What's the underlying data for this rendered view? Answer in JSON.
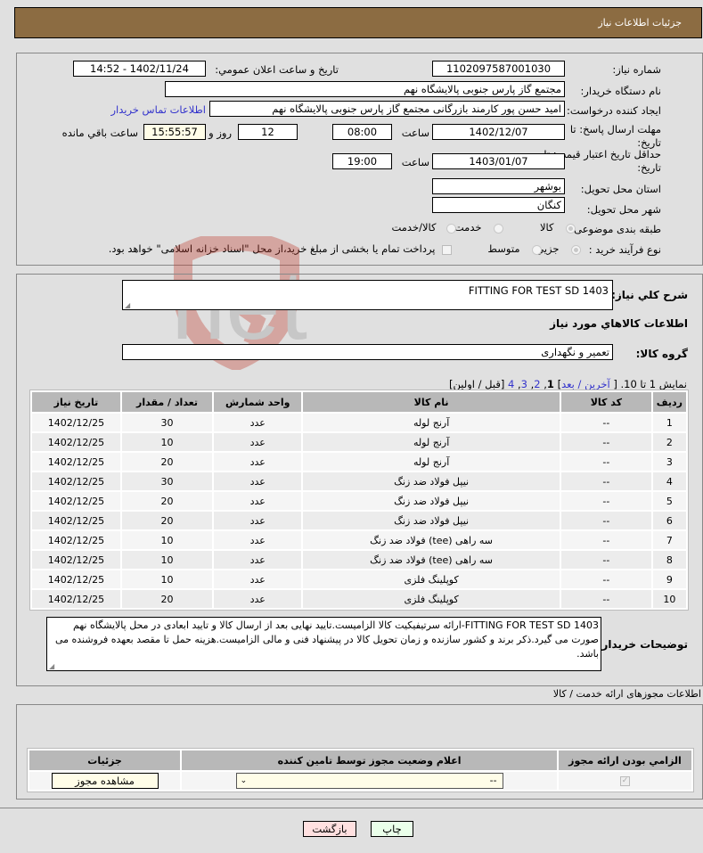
{
  "header": {
    "title": "جزئیات اطلاعات نیاز"
  },
  "details": {
    "need_number_label": "شماره نیاز:",
    "need_number": "1102097587001030",
    "announce_label": "تاریخ و ساعت اعلان عمومي:",
    "announce_value": "1402/11/24 - 14:52",
    "buyer_org_label": "نام دستگاه خریدار:",
    "buyer_org": "مجتمع گاز پارس جنوبی  پالایشگاه نهم",
    "creator_label": "ایجاد کننده درخواست:",
    "creator": "امید حسن پور کارمند بازرگانی مجتمع گاز پارس جنوبی  پالایشگاه نهم",
    "contact_link": "اطلاعات تماس خریدار",
    "reply_deadline_label_1": "مهلت ارسال پاسخ: تا",
    "reply_deadline_label_2": "تاریخ:",
    "reply_date": "1402/12/07",
    "time_label": "ساعت",
    "reply_time": "08:00",
    "days_value": "12",
    "days_label": "روز و",
    "remaining_time": "15:55:57",
    "remaining_label": "ساعت باقي مانده",
    "price_validity_label_1": "حداقل تاریخ اعتبار قیمت: تا",
    "price_validity_label_2": "تاریخ:",
    "price_validity_date": "1403/01/07",
    "price_validity_time": "19:00",
    "province_label": "استان محل تحویل:",
    "province": "بوشهر",
    "city_label": "شهر محل تحویل:",
    "city": "کنگان",
    "category_label": "طبقه بندی موضوعی:",
    "category_options": [
      "کالا",
      "خدمت",
      "کالا/خدمت"
    ],
    "category_selected": "کالا",
    "process_label": "نوع فرآیند خرید :",
    "process_options": [
      "جزیي",
      "متوسط"
    ],
    "process_selected": "جزیي",
    "payment_note": "پرداخت تمام یا بخشی از مبلغ خرید،از محل \"اسناد خزانه اسلامی\" خواهد بود."
  },
  "watermark": "AriaTender.net",
  "goods": {
    "summary_label": "شرح کلي نیاز:",
    "summary": "FITTING FOR TEST SD 1403",
    "section_title": "اطلاعات کالاهاي مورد نیاز",
    "group_label": "گروه کالا:",
    "group": "تعمیر و نگهداری",
    "pager": {
      "showing": "نمایش 1 تا 10.",
      "open": "[",
      "last": "آخرین",
      "sep": "/",
      "next": "بعد",
      "close": "]",
      "pages": [
        "4",
        "3",
        "2"
      ],
      "current": "1",
      "prev_first": "[قبل / اولین]"
    },
    "columns": [
      "ردیف",
      "کد کالا",
      "نام کالا",
      "واحد شمارش",
      "تعداد / مقدار",
      "تاریخ نیاز"
    ],
    "rows": [
      [
        "1",
        "--",
        "آرنج لوله",
        "عدد",
        "30",
        "1402/12/25"
      ],
      [
        "2",
        "--",
        "آرنج لوله",
        "عدد",
        "10",
        "1402/12/25"
      ],
      [
        "3",
        "--",
        "آرنج لوله",
        "عدد",
        "20",
        "1402/12/25"
      ],
      [
        "4",
        "--",
        "نیپل فولاد ضد زنگ",
        "عدد",
        "30",
        "1402/12/25"
      ],
      [
        "5",
        "--",
        "نیپل فولاد ضد زنگ",
        "عدد",
        "20",
        "1402/12/25"
      ],
      [
        "6",
        "--",
        "نیپل فولاد ضد زنگ",
        "عدد",
        "20",
        "1402/12/25"
      ],
      [
        "7",
        "--",
        "سه راهی (tee) فولاد ضد زنگ",
        "عدد",
        "10",
        "1402/12/25"
      ],
      [
        "8",
        "--",
        "سه راهی (tee) فولاد ضد زنگ",
        "عدد",
        "10",
        "1402/12/25"
      ],
      [
        "9",
        "--",
        "کوپلینگ فلزی",
        "عدد",
        "10",
        "1402/12/25"
      ],
      [
        "10",
        "--",
        "کوپلینگ فلزی",
        "عدد",
        "20",
        "1402/12/25"
      ]
    ],
    "buyer_notes_label": "توضیحات خریدار:",
    "buyer_notes": "FITTING FOR TEST SD 1403-ارائه سرتیفیکیت کالا الزامیست.تایید نهایی بعد از ارسال کالا و تایید ابعادی در محل پالایشگاه نهم صورت می گیرد.ذکر برند و کشور سازنده و زمان تحویل کالا در پیشنهاد فنی و مالی الزامیست.هزینه حمل تا مقصد بعهده فروشنده می باشد."
  },
  "permits": {
    "title": "اطلاعات مجوزهای ارائه خدمت / کالا",
    "columns": [
      "الزامي بودن ارائه مجوز",
      "اعلام وضعیت مجوز توسط تامین کننده",
      "جزئیات"
    ],
    "row": {
      "required_checked": true,
      "status_value": "--",
      "view_button": "مشاهده مجوز"
    }
  },
  "actions": {
    "print": "چاپ",
    "back": "بازگشت"
  }
}
